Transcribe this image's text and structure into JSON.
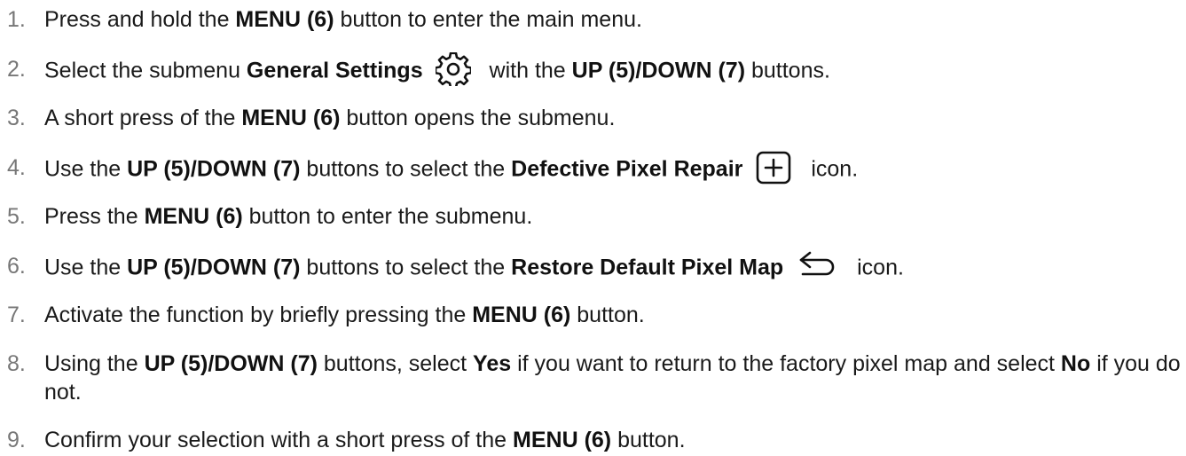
{
  "steps": [
    {
      "number": "1.",
      "parts": [
        "Press and hold the ",
        "MENU (6)",
        " button to enter the main menu."
      ]
    },
    {
      "number": "2.",
      "parts": [
        "Select the submenu ",
        "General Settings",
        " with the ",
        "UP (5)/DOWN (7)",
        " buttons."
      ],
      "icon": "gear-icon"
    },
    {
      "number": "3.",
      "parts": [
        "A short press of the ",
        "MENU (6)",
        " button opens the submenu."
      ]
    },
    {
      "number": "4.",
      "parts": [
        "Use the ",
        "UP (5)/DOWN (7)",
        " buttons to select the ",
        "Defective Pixel Repair",
        " icon."
      ],
      "icon": "plus-box-icon"
    },
    {
      "number": "5.",
      "parts": [
        "Press the ",
        "MENU (6)",
        " button to enter the submenu."
      ]
    },
    {
      "number": "6.",
      "parts": [
        "Use the ",
        "UP (5)/DOWN (7)",
        " buttons to select the ",
        "Restore Default Pixel Map",
        " icon."
      ],
      "icon": "return-arrow-icon"
    },
    {
      "number": "7.",
      "parts": [
        "Activate the function by briefly pressing the ",
        "MENU (6)",
        " button."
      ]
    },
    {
      "number": "8.",
      "parts": [
        "Using the ",
        "UP (5)/DOWN (7)",
        " buttons, select ",
        "Yes",
        " if you want to return to the factory pixel map and select ",
        "No",
        " if you do not."
      ]
    },
    {
      "number": "9.",
      "parts": [
        "Confirm your selection with a short press of the ",
        "MENU (6)",
        " button."
      ]
    }
  ]
}
